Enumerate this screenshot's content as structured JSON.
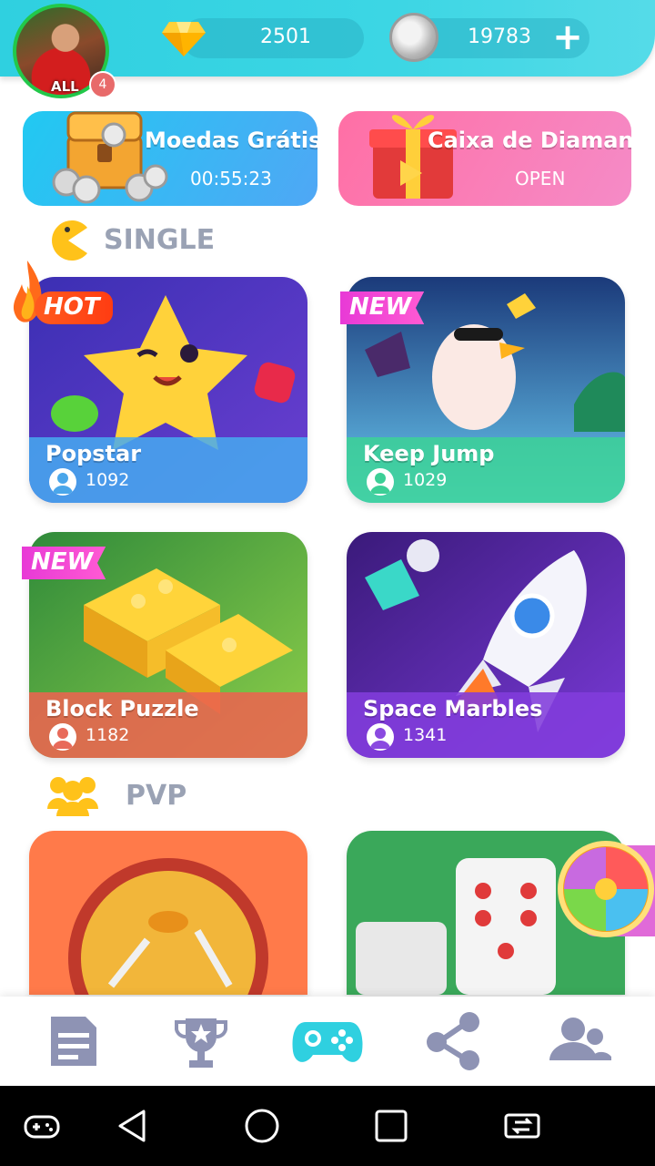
{
  "header": {
    "avatar_name": "ALL",
    "notification_count": "4",
    "gems": "2501",
    "coins": "19783",
    "add_label": "+"
  },
  "promos": {
    "free_coins": {
      "title": "Moedas Grátis",
      "timer": "00:55:23"
    },
    "diamond_box": {
      "title": "Caixa de Diamante",
      "status": "OPEN"
    }
  },
  "sections": {
    "single": "SINGLE",
    "pvp": "PVP"
  },
  "games": [
    {
      "name": "Popstar",
      "players": "1092",
      "tag": "HOT"
    },
    {
      "name": "Keep Jump",
      "players": "1029",
      "tag": "NEW"
    },
    {
      "name": "Block Puzzle",
      "players": "1182",
      "tag": "NEW"
    },
    {
      "name": "Space Marbles",
      "players": "1341",
      "tag": ""
    }
  ],
  "nav": [
    "news-icon",
    "trophy-icon",
    "gamepad-icon",
    "share-icon",
    "friends-icon"
  ],
  "colors": {
    "header": "#3cd6e4",
    "accent_blue": "#21c9f2",
    "accent_pink": "#ff6fa5",
    "nav_active": "#2fd0e0",
    "nav_inactive": "#8e93b4"
  }
}
